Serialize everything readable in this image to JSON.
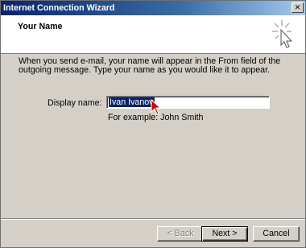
{
  "window": {
    "title": "Internet Connection Wizard",
    "close_label": "✕"
  },
  "header": {
    "title": "Your Name",
    "icon": "wizard-sparkle-icon"
  },
  "content": {
    "intro": "When you send e-mail, your name will appear in the From field of the outgoing message. Type your name as you would like it to appear.",
    "display_name_label": "Display name:",
    "display_name_value": "Ivan Ivanov",
    "example": "For example: John Smith"
  },
  "buttons": {
    "back": "< Back",
    "next": "Next >",
    "cancel": "Cancel"
  },
  "colors": {
    "selection": "#0a246a",
    "titlebar_start": "#0a246a",
    "titlebar_end": "#a6caf0",
    "cursor": "#cc0000"
  }
}
